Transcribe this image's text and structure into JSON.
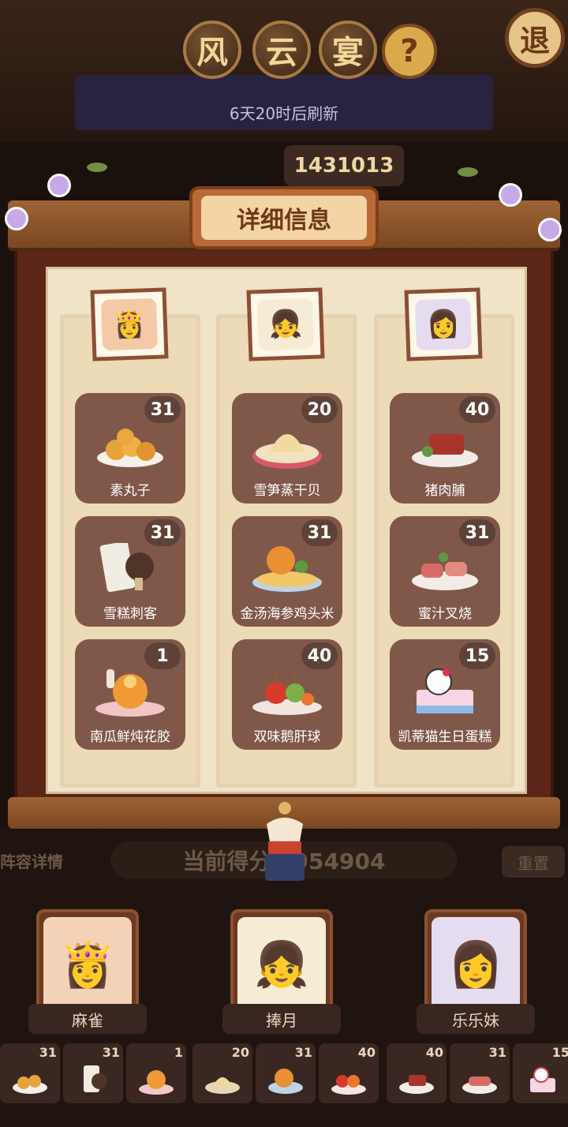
{
  "header": {
    "title_chars": [
      "风",
      "云",
      "宴"
    ],
    "help_label": "?",
    "back_label": "退",
    "refresh_text": "6天20时后刷新",
    "top_score": "1431013"
  },
  "panel": {
    "title": "详细信息",
    "columns": [
      {
        "character": "麻雀",
        "portrait_icon": "👸",
        "dishes": [
          {
            "name": "素丸子",
            "count": "31",
            "icon": "dumpling-plate-icon"
          },
          {
            "name": "雪糕刺客",
            "count": "31",
            "icon": "ice-cream-icon"
          },
          {
            "name": "南瓜鲜炖花胶",
            "count": "1",
            "icon": "pumpkin-stew-icon"
          }
        ]
      },
      {
        "character": "捧月",
        "portrait_icon": "👧",
        "dishes": [
          {
            "name": "雪笋蒸干贝",
            "count": "20",
            "icon": "steamed-scallop-icon"
          },
          {
            "name": "金汤海参鸡头米",
            "count": "31",
            "icon": "golden-soup-icon"
          },
          {
            "name": "双味鹅肝球",
            "count": "40",
            "icon": "foie-gras-ball-icon"
          }
        ]
      },
      {
        "character": "乐乐妹",
        "portrait_icon": "👩",
        "dishes": [
          {
            "name": "猪肉脯",
            "count": "40",
            "icon": "jerky-plate-icon"
          },
          {
            "name": "蜜汁叉烧",
            "count": "31",
            "icon": "char-siu-icon"
          },
          {
            "name": "凯蒂猫生日蛋糕",
            "count": "15",
            "icon": "birthday-cake-icon"
          }
        ]
      }
    ]
  },
  "bottom": {
    "lineup_label": "阵容详情",
    "current_score": "当前得分：954904",
    "reset_label": "重置",
    "members": [
      {
        "name": "麻雀",
        "icon": "👸"
      },
      {
        "name": "捧月",
        "icon": "👧"
      },
      {
        "name": "乐乐妹",
        "icon": "👩"
      }
    ],
    "slots": [
      "31",
      "31",
      "1",
      "20",
      "31",
      "40",
      "40",
      "31",
      "15"
    ]
  },
  "colors": {
    "panel_frame": "#5b2618",
    "paper": "#f1e3c7",
    "card": "#80584a",
    "heading": "#b86a38"
  }
}
